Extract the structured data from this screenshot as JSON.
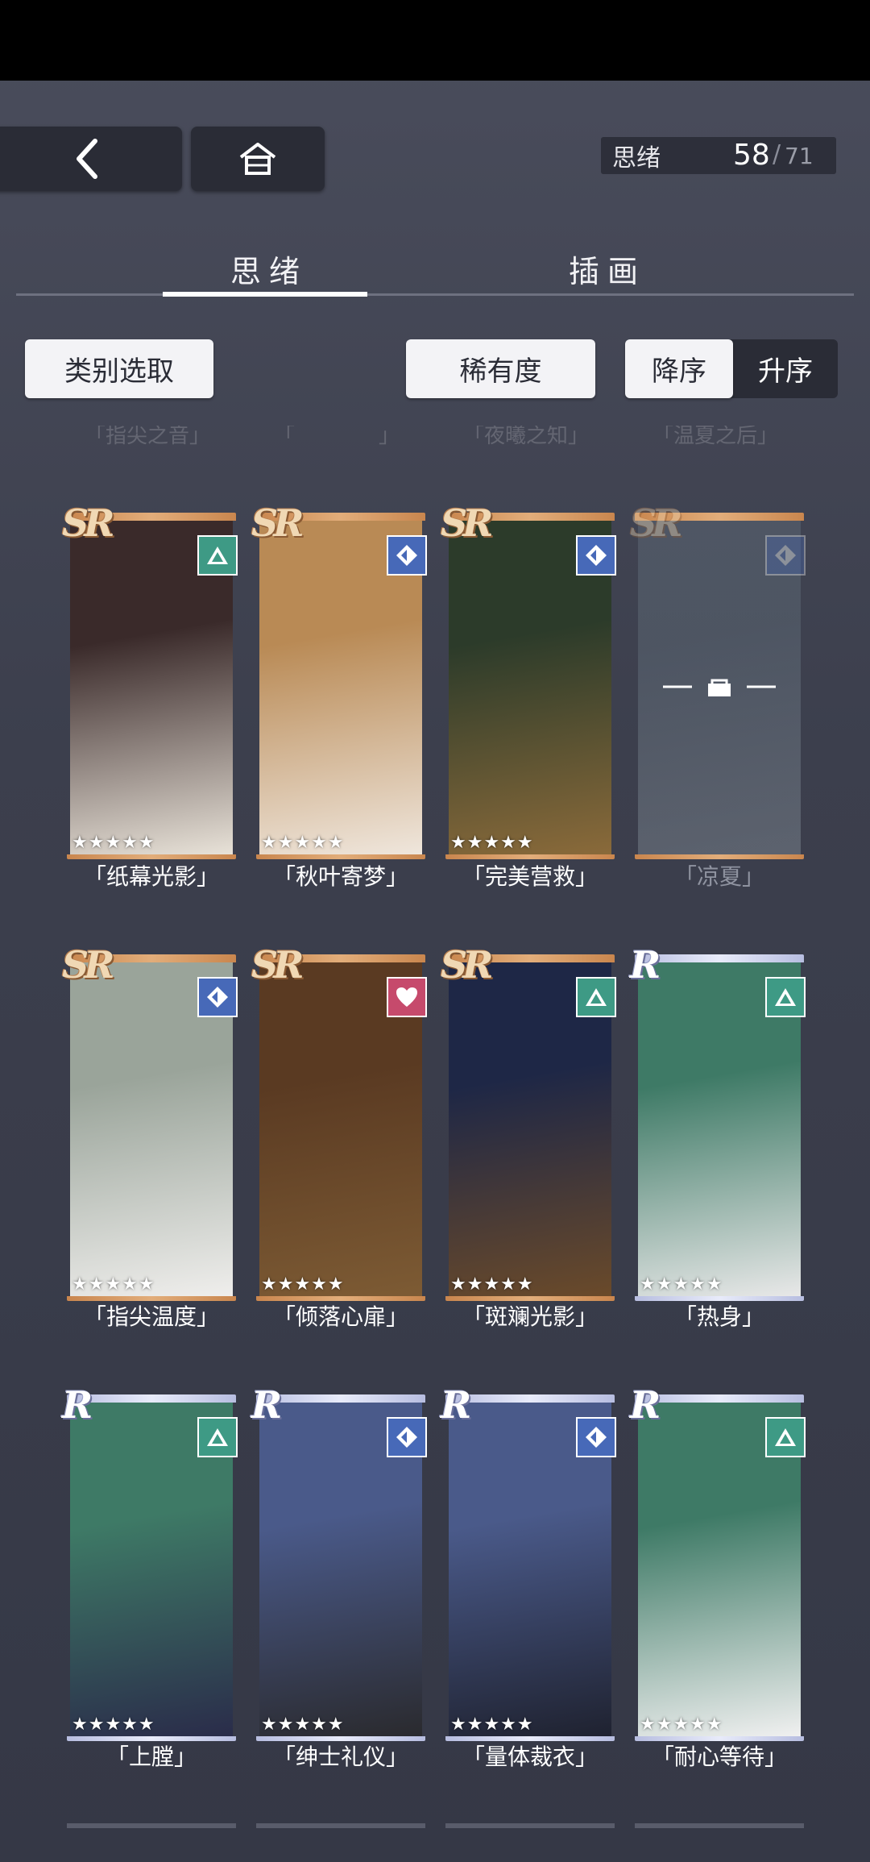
{
  "header": {
    "counter_label": "思绪",
    "counter_current": "58",
    "counter_separator": "/",
    "counter_total": "71"
  },
  "tabs": [
    {
      "label": "思绪",
      "active": true
    },
    {
      "label": "插画",
      "active": false
    }
  ],
  "filters": {
    "category": "类别选取",
    "rarity": "稀有度",
    "desc": "降序",
    "asc": "升序"
  },
  "ghost_titles": [
    "「指尖之音」",
    "「　　　　」",
    "「夜曦之知」",
    "「温夏之后」"
  ],
  "cards": [
    {
      "rarity": "SR",
      "attr": "triangle",
      "stars": "★★★★★",
      "title": "「纸幕光影」",
      "locked": false,
      "art": [
        "#3a2a2a",
        "#e8e2d8"
      ]
    },
    {
      "rarity": "SR",
      "attr": "diamond",
      "stars": "★★★★★",
      "title": "「秋叶寄梦」",
      "locked": false,
      "art": [
        "#b98a55",
        "#efe6dc"
      ]
    },
    {
      "rarity": "SR",
      "attr": "diamond",
      "stars": "★★★★★",
      "title": "「完美营救」",
      "locked": false,
      "art": [
        "#2c3b2a",
        "#8a6a3a"
      ]
    },
    {
      "rarity": "SR",
      "attr": "diamond",
      "stars": "",
      "title": "「凉夏」",
      "locked": true,
      "art": [
        "#6a7a86",
        "#9aa6ae"
      ]
    },
    {
      "rarity": "SR",
      "attr": "diamond",
      "stars": "★★★★★",
      "title": "「指尖温度」",
      "locked": false,
      "art": [
        "#9aa49a",
        "#efeeec"
      ]
    },
    {
      "rarity": "SR",
      "attr": "heart",
      "stars": "★★★★★",
      "title": "「倾落心扉」",
      "locked": false,
      "art": [
        "#5a3a22",
        "#7d5b34"
      ]
    },
    {
      "rarity": "SR",
      "attr": "triangle",
      "stars": "★★★★★",
      "title": "「斑斓光影」",
      "locked": false,
      "art": [
        "#1e2746",
        "#6a4a2a"
      ]
    },
    {
      "rarity": "R",
      "attr": "triangle",
      "stars": "★★★★★",
      "title": "「热身」",
      "locked": false,
      "art": [
        "#3e7a66",
        "#e8e8e8"
      ]
    },
    {
      "rarity": "R",
      "attr": "triangle",
      "stars": "★★★★★",
      "title": "「上膛」",
      "locked": false,
      "art": [
        "#3e7a66",
        "#2a2c4a"
      ]
    },
    {
      "rarity": "R",
      "attr": "diamond",
      "stars": "★★★★★",
      "title": "「绅士礼仪」",
      "locked": false,
      "art": [
        "#4a5a8a",
        "#2a2a2e"
      ]
    },
    {
      "rarity": "R",
      "attr": "diamond",
      "stars": "★★★★★",
      "title": "「量体裁衣」",
      "locked": false,
      "art": [
        "#4a5a8a",
        "#1f2230"
      ]
    },
    {
      "rarity": "R",
      "attr": "triangle",
      "stars": "★★★★★",
      "title": "「耐心等待」",
      "locked": false,
      "art": [
        "#3e7a66",
        "#f0f0f0"
      ]
    }
  ]
}
